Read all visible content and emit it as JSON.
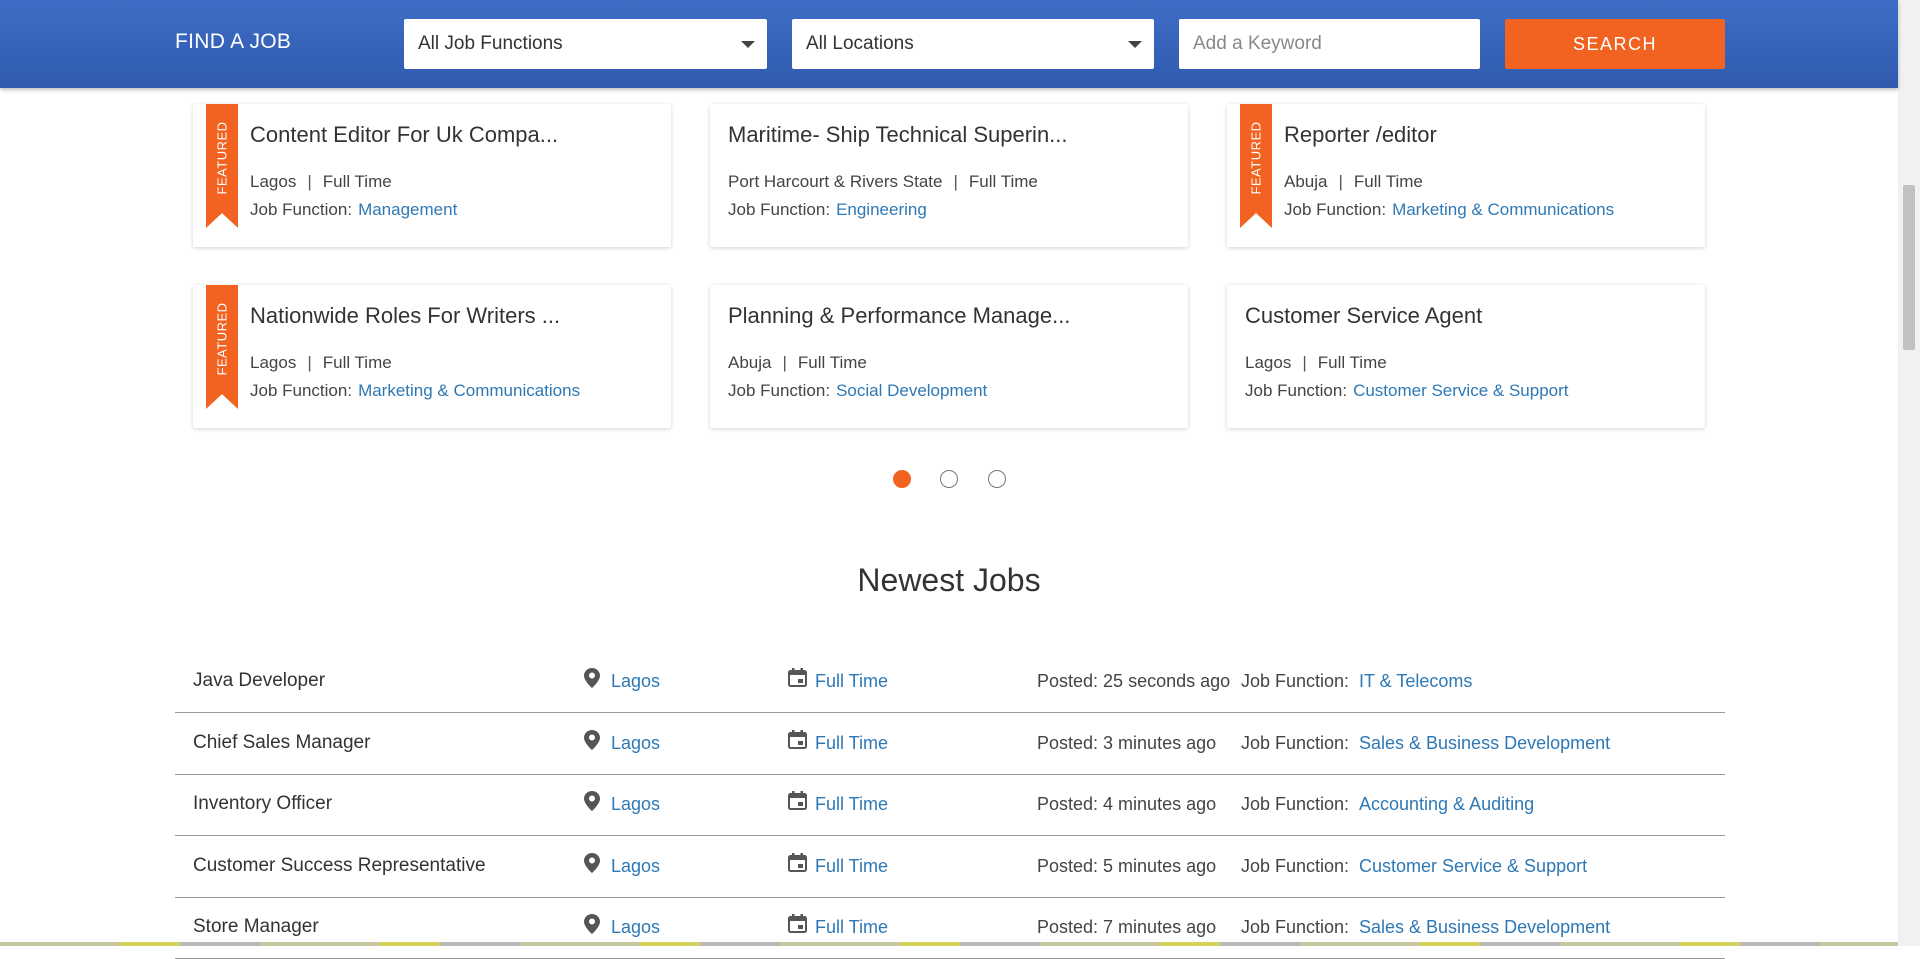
{
  "header": {
    "brand": "FIND A JOB",
    "job_function_select": "All Job Functions",
    "location_select": "All Locations",
    "keyword_placeholder": "Add a Keyword",
    "search_label": "SEARCH"
  },
  "featured_cards": [
    {
      "title": "Content Editor For Uk Compa...",
      "featured": true,
      "featured_label": "FEATURED",
      "location": "Lagos",
      "type": "Full Time",
      "function_label": "Job Function:",
      "function": "Management"
    },
    {
      "title": "Maritime- Ship Technical Superin...",
      "featured": false,
      "location": "Port Harcourt & Rivers State",
      "type": "Full Time",
      "function_label": "Job Function:",
      "function": "Engineering"
    },
    {
      "title": "Reporter /editor",
      "featured": true,
      "featured_label": "FEATURED",
      "location": "Abuja",
      "type": "Full Time",
      "function_label": "Job Function:",
      "function": "Marketing & Communications"
    },
    {
      "title": "Nationwide Roles For Writers ...",
      "featured": true,
      "featured_label": "FEATURED",
      "location": "Lagos",
      "type": "Full Time",
      "function_label": "Job Function:",
      "function": "Marketing & Communications"
    },
    {
      "title": "Planning & Performance Manage...",
      "featured": false,
      "location": "Abuja",
      "type": "Full Time",
      "function_label": "Job Function:",
      "function": "Social Development"
    },
    {
      "title": "Customer Service Agent",
      "featured": false,
      "location": "Lagos",
      "type": "Full Time",
      "function_label": "Job Function:",
      "function": "Customer Service & Support"
    }
  ],
  "carousel": {
    "pages": 3,
    "active": 1
  },
  "newest": {
    "title": "Newest Jobs",
    "rows": [
      {
        "title": "Java Developer",
        "location": "Lagos",
        "type": "Full Time",
        "posted": "Posted: 25 seconds ago",
        "function_label": "Job Function:",
        "function": "IT & Telecoms"
      },
      {
        "title": "Chief Sales Manager",
        "location": "Lagos",
        "type": "Full Time",
        "posted": "Posted: 3 minutes ago",
        "function_label": "Job Function:",
        "function": "Sales & Business Development"
      },
      {
        "title": "Inventory Officer",
        "location": "Lagos",
        "type": "Full Time",
        "posted": "Posted: 4 minutes ago",
        "function_label": "Job Function:",
        "function": "Accounting & Auditing"
      },
      {
        "title": "Customer Success Representative",
        "location": "Lagos",
        "type": "Full Time",
        "posted": "Posted: 5 minutes ago",
        "function_label": "Job Function:",
        "function": "Customer Service & Support"
      },
      {
        "title": "Store Manager",
        "location": "Lagos",
        "type": "Full Time",
        "posted": "Posted: 7 minutes ago",
        "function_label": "Job Function:",
        "function": "Sales & Business Development"
      }
    ]
  },
  "colors": {
    "header": "#3a67c0",
    "accent": "#f26322",
    "link": "#2e78b5"
  },
  "icons": {
    "location": "map-pin-icon",
    "type": "calendar-icon",
    "dropdown": "caret-down-icon"
  }
}
